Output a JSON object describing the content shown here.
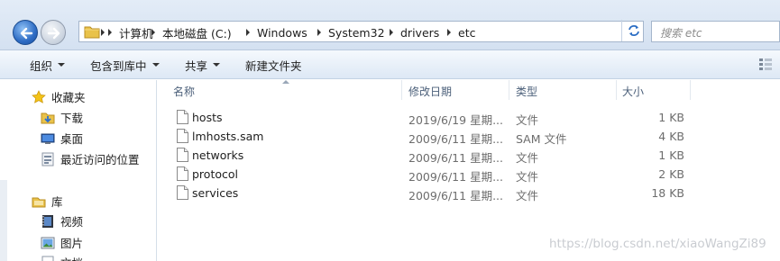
{
  "address": {
    "crumbs": [
      "计算机",
      "本地磁盘 (C:)",
      "Windows",
      "System32",
      "drivers",
      "etc"
    ]
  },
  "search": {
    "placeholder": "搜索 etc"
  },
  "toolbar": {
    "organize": "组织",
    "include_in_library": "包含到库中",
    "share": "共享",
    "new_folder": "新建文件夹"
  },
  "nav": {
    "favorites": "收藏夹",
    "downloads": "下载",
    "desktop": "桌面",
    "recent": "最近访问的位置",
    "libraries": "库",
    "videos": "视频",
    "pictures": "图片",
    "documents": "文档"
  },
  "columns": {
    "name": "名称",
    "date": "修改日期",
    "type": "类型",
    "size": "大小"
  },
  "files": [
    {
      "name": "hosts",
      "date": "2019/6/19 星期...",
      "type": "文件",
      "size": "1 KB"
    },
    {
      "name": "lmhosts.sam",
      "date": "2009/6/11 星期...",
      "type": "SAM 文件",
      "size": "4 KB"
    },
    {
      "name": "networks",
      "date": "2009/6/11 星期...",
      "type": "文件",
      "size": "1 KB"
    },
    {
      "name": "protocol",
      "date": "2009/6/11 星期...",
      "type": "文件",
      "size": "2 KB"
    },
    {
      "name": "services",
      "date": "2009/6/11 星期...",
      "type": "文件",
      "size": "18 KB"
    }
  ],
  "watermark": "https://blog.csdn.net/xiaoWangZi89"
}
